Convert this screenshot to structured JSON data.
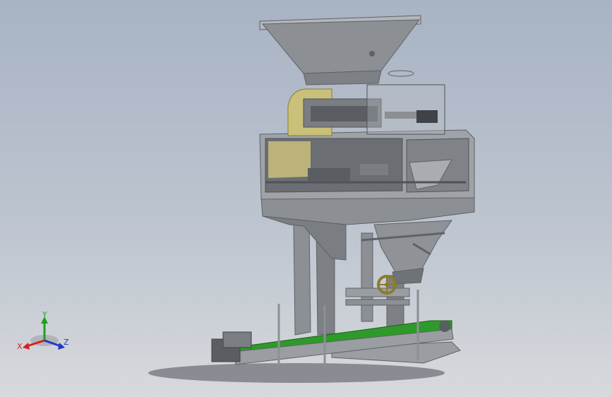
{
  "viewport": {
    "background_top": "#a8b3c4",
    "background_bottom": "#d7d9dc"
  },
  "model": {
    "colors": {
      "frame": "#8c8f93",
      "frame_dark": "#5f6266",
      "frame_light": "#b3b6ba",
      "belt": "#2e9a2a",
      "guard": "#c9c07a",
      "wheel": "#8a7d2a",
      "shadow": "#4b4f57"
    }
  },
  "triad": {
    "x_label": "X",
    "y_label": "Y",
    "z_label": "Z",
    "x_color": "#d42020",
    "y_color": "#1f9e1f",
    "z_color": "#2038c8"
  }
}
